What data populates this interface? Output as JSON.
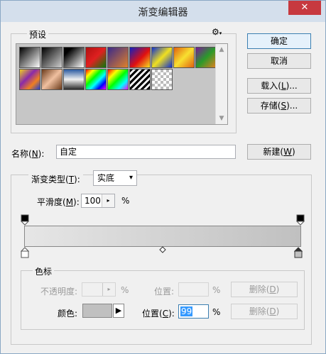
{
  "window": {
    "title": "渐变编辑器",
    "close_glyph": "✕"
  },
  "presets": {
    "group_label": "预设",
    "gear_glyph": "⚙",
    "swatches": [
      {
        "name": "foreground-to-background",
        "fill": "linear-gradient(135deg,#000 0%,#fff 100%)"
      },
      {
        "name": "foreground-to-transparent",
        "fill": "linear-gradient(135deg,#000 0%,#cfcfcf 100%)"
      },
      {
        "name": "black-to-white",
        "fill": "linear-gradient(135deg,#000 20%,#fff 100%)"
      },
      {
        "name": "red-green",
        "fill": "linear-gradient(135deg,#b01010 0%,#e02020 50%,#0a7a0a 100%)"
      },
      {
        "name": "violet-orange",
        "fill": "linear-gradient(135deg,#3a2a8a 0%,#e0802a 100%)"
      },
      {
        "name": "blue-red-yellow",
        "fill": "linear-gradient(135deg,#1020c0 0%,#e01010 55%,#f5e020 100%)"
      },
      {
        "name": "blue-yellow-blue",
        "fill": "linear-gradient(135deg,#1030d0 0%,#f0e020 50%,#1030d0 100%)"
      },
      {
        "name": "orange-yellow-orange",
        "fill": "linear-gradient(135deg,#e06010 0%,#f8e030 50%,#e06010 100%)"
      },
      {
        "name": "violet-green-orange",
        "fill": "linear-gradient(135deg,#7a1a9a 0%,#2a9a2a 50%,#e08020 100%)"
      },
      {
        "name": "yellow-violet-orange-blue",
        "fill": "linear-gradient(135deg,#f0d020 0%,#8a2aaa 40%,#f08020 70%,#2040d0 100%)"
      },
      {
        "name": "copper",
        "fill": "linear-gradient(135deg,#6a3a1a 0%,#f0c0a0 50%,#6a3a1a 100%)"
      },
      {
        "name": "chrome",
        "fill": "linear-gradient(180deg,#2a5aa0 0%,#f0f0f0 50%,#2a2a2a 100%)"
      },
      {
        "name": "spectrum",
        "fill": "linear-gradient(135deg,#f00 0%,#ff0 20%,#0f0 40%,#0ff 60%,#00f 80%,#f0f 100%)"
      },
      {
        "name": "transparent-rainbow",
        "fill": "linear-gradient(135deg,#f00 0%,#ff0 25%,#0f0 50%,#0ff 75%,#f0f 100%)"
      },
      {
        "name": "transparent-stripes",
        "fill": "repeating-linear-gradient(135deg,#000 0px,#000 3px,#fff 3px,#fff 6px)"
      },
      {
        "name": "transparent-checker",
        "fill": "repeating-conic-gradient(#bbb 0% 25%,#fff 0% 50%) 0 0/8px 8px"
      }
    ]
  },
  "buttons": {
    "ok": "确定",
    "cancel": "取消",
    "load_prefix": "载入(",
    "load_key": "L",
    "load_suffix": ")...",
    "save_prefix": "存储(",
    "save_key": "S",
    "save_suffix": ")...",
    "new_prefix": "新建(",
    "new_key": "W",
    "new_suffix": ")"
  },
  "name_field": {
    "label_prefix": "名称(",
    "label_key": "N",
    "label_suffix": "):",
    "value": "自定"
  },
  "gradient": {
    "type_label_prefix": "渐变类型(",
    "type_label_key": "T",
    "type_label_suffix": "):",
    "type_value": "实底",
    "smoothness_label_prefix": "平滑度(",
    "smoothness_label_key": "M",
    "smoothness_label_suffix": "):",
    "smoothness_value": "100",
    "percent": "%",
    "start_color": "#e6e6e6",
    "end_color": "#c0c0c0",
    "midpoint_percent": 50
  },
  "color_stops": {
    "group_label": "色标",
    "opacity_label": "不透明度:",
    "opacity_location_label": "位置:",
    "opacity_delete_prefix": "删除(",
    "opacity_delete_key": "D",
    "opacity_delete_suffix": ")",
    "color_label": "颜色:",
    "color_swatch": "#c0c0c0",
    "color_location_prefix": "位置(",
    "color_location_key": "C",
    "color_location_suffix": "):",
    "location_value": "99",
    "color_delete_prefix": "删除(",
    "color_delete_key": "D",
    "color_delete_suffix": ")"
  }
}
